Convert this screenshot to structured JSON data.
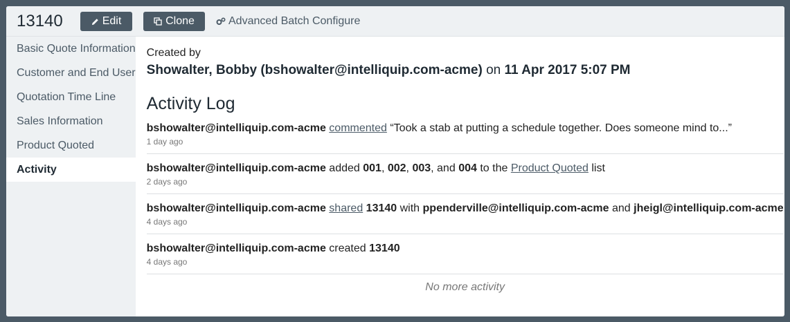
{
  "header": {
    "quote_id": "13140",
    "edit_label": "Edit",
    "clone_label": "Clone",
    "batch_label": "Advanced Batch Configure"
  },
  "sidebar": {
    "items": [
      {
        "label": "Basic Quote Information"
      },
      {
        "label": "Customer and End User"
      },
      {
        "label": "Quotation Time Line"
      },
      {
        "label": "Sales Information"
      },
      {
        "label": "Product Quoted"
      },
      {
        "label": "Activity"
      }
    ]
  },
  "main": {
    "created_by_label": "Created by",
    "creator": "Showalter, Bobby (bshowalter@intelliquip.com-acme)",
    "on_word": "on",
    "created_date": "11 Apr 2017 5:07 PM",
    "activity_title": "Activity Log",
    "entries": [
      {
        "user": "bshowalter@intelliquip.com-acme",
        "link": "commented",
        "text": "“Took a stab at putting a schedule together. Does someone mind to...”",
        "time": "1 day ago"
      },
      {
        "user": "bshowalter@intelliquip.com-acme",
        "added": "added",
        "i1": "001",
        "i2": "002",
        "i3": "003",
        "and": "and",
        "i4": "004",
        "to_the": "to the",
        "link": "Product Quoted",
        "list": "list",
        "time": "2 days ago"
      },
      {
        "user": "bshowalter@intelliquip.com-acme",
        "link": "shared",
        "item": "13140",
        "with": "with",
        "u1": "ppenderville@intelliquip.com-acme",
        "and": "and",
        "u2": "jheigl@intelliquip.com-acme",
        "time": "4 days ago"
      },
      {
        "user": "bshowalter@intelliquip.com-acme",
        "created": "created",
        "item": "13140",
        "time": "4 days ago"
      }
    ],
    "no_more": "No more activity"
  }
}
